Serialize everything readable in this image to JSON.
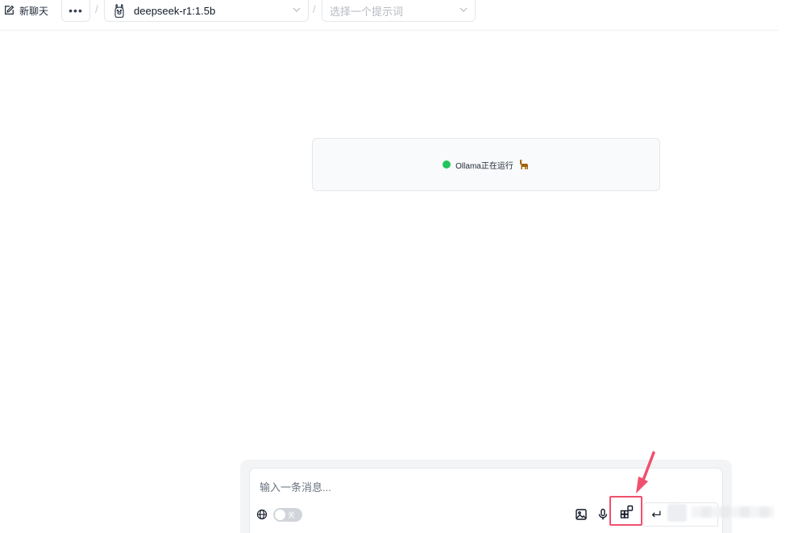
{
  "toolbar": {
    "new_chat_label": "新聊天",
    "more_label": "•••",
    "separator": "/",
    "model_select_value": "deepseek-r1:1.5b",
    "prompt_select_placeholder": "选择一个提示词"
  },
  "status": {
    "text": "Ollama正在运行",
    "dot_color": "#22c55e"
  },
  "composer": {
    "placeholder": "输入一条消息...",
    "web_toggle_label": "关",
    "web_toggle_state": "off"
  },
  "annotation": {
    "highlight_color": "#f0506e"
  },
  "icons": [
    "edit-icon",
    "more-icon",
    "llama-icon",
    "chevron-down-icon",
    "globe-icon",
    "image-icon",
    "microphone-icon",
    "extension-icon",
    "enter-icon"
  ]
}
